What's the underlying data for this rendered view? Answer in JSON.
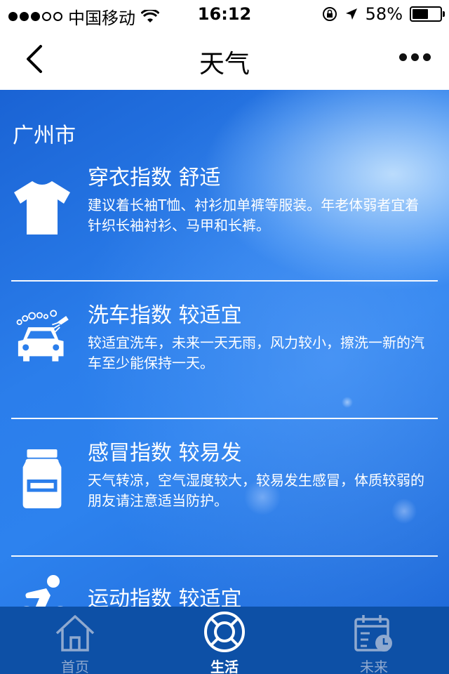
{
  "status_bar": {
    "carrier": "中国移动",
    "time": "16:12",
    "battery_text": "58%",
    "battery_level": 0.58,
    "signal_bars_filled": 3,
    "signal_bars_total": 5
  },
  "nav": {
    "title": "天气",
    "back_icon": "chevron-left-icon",
    "more_icon": "more-dots-icon"
  },
  "city": "广州市",
  "indices": [
    {
      "name": "穿衣指数 舒适",
      "desc": "建议着长袖T恤、衬衫加单裤等服装。年老体弱者宜着针织长袖衬衫、马甲和长裤。",
      "icon": "tshirt-icon"
    },
    {
      "name": "洗车指数 较适宜",
      "desc": "较适宜洗车，未来一天无雨，风力较小，擦洗一新的汽车至少能保持一天。",
      "icon": "car-wash-icon"
    },
    {
      "name": "感冒指数 较易发",
      "desc": "天气转凉，空气湿度较大，较易发生感冒，体质较弱的朋友请注意适当防护。",
      "icon": "medicine-bottle-icon"
    },
    {
      "name": "运动指数 较适宜",
      "desc": "",
      "icon": "cyclist-icon"
    }
  ],
  "tabs": [
    {
      "label": "首页",
      "icon": "home-icon",
      "active": false
    },
    {
      "label": "生活",
      "icon": "lifebuoy-icon",
      "active": true
    },
    {
      "label": "未来",
      "icon": "calendar-clock-icon",
      "active": false
    }
  ],
  "colors": {
    "content_bg": "#2b7eeb",
    "tab_bar_bg": "#0d50a6",
    "tab_inactive": "#8fa9cf",
    "tab_active": "#ffffff"
  }
}
